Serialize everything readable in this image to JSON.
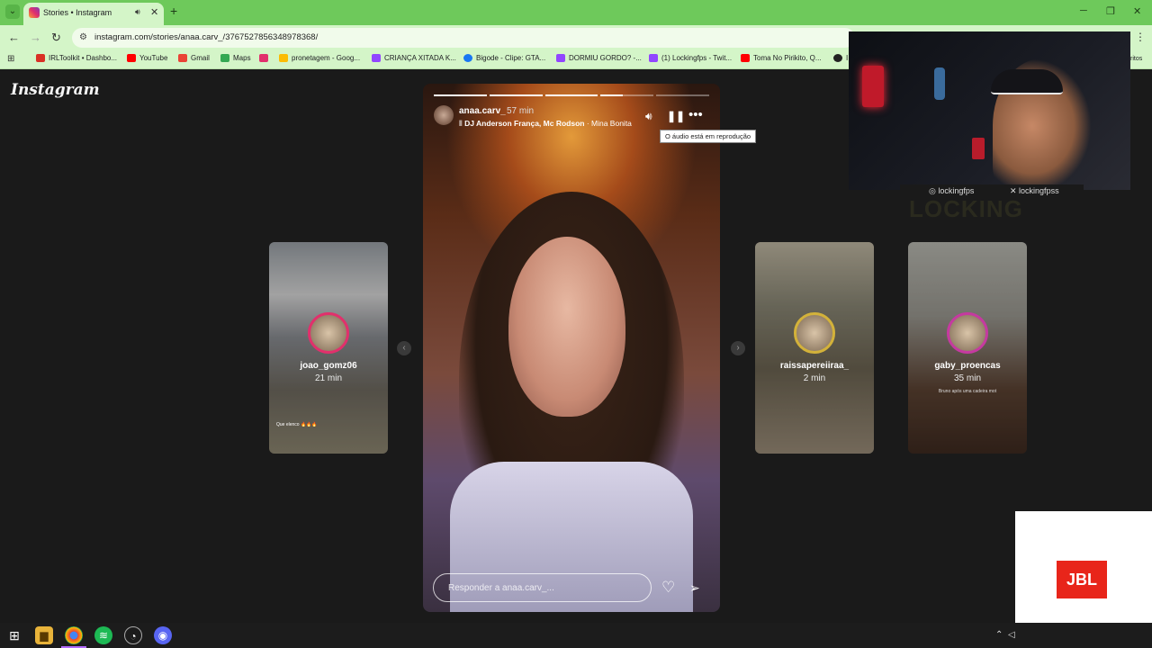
{
  "browser": {
    "tab_title": "Stories • Instagram",
    "url": "instagram.com/stories/anaa.carv_/3767527856348978368/",
    "bookmarks": [
      "IRLToolkit • Dashbo...",
      "YouTube",
      "Gmail",
      "Maps",
      "",
      "pronetagem - Goog...",
      "CRIANÇA XITADA K...",
      "Bigode - Clipe: GTA...",
      "DORMIU GORDO? -...",
      "(1) Lockingfps - Twit...",
      "Toma No Pirikito, Q...",
      "I"
    ],
    "bookmarks_right": "ritos"
  },
  "instagram": {
    "logo": "Instagram",
    "story": {
      "username": "anaa.carv_",
      "time": "57 min",
      "music_artists": "DJ Anderson França, Mc Rodson",
      "music_title": "· Mina Bonita",
      "tooltip": "O áudio está em reprodução",
      "reply_placeholder": "Responder a anaa.carv_...",
      "progress": [
        1,
        1,
        1,
        0.42,
        0
      ]
    },
    "previews": [
      {
        "username": "joao_gomz06",
        "time": "21 min",
        "caption": "Que elenco 🔥🔥🔥"
      },
      {
        "username": "raissapereiiraa_",
        "time": "2 min"
      },
      {
        "username": "gaby_proencas",
        "time": "35 min",
        "caption": "Bruno após uma cadeira mot"
      }
    ]
  },
  "stream_overlay": {
    "handle_1": "lockingfps",
    "handle_2": "lockingfpss",
    "brand": "LOCKING",
    "sponsor": "JBL"
  },
  "colors": {
    "tab_bar": "#6ec95b",
    "toolbar": "#d4f5c8",
    "page_bg": "#1a1a1a"
  }
}
